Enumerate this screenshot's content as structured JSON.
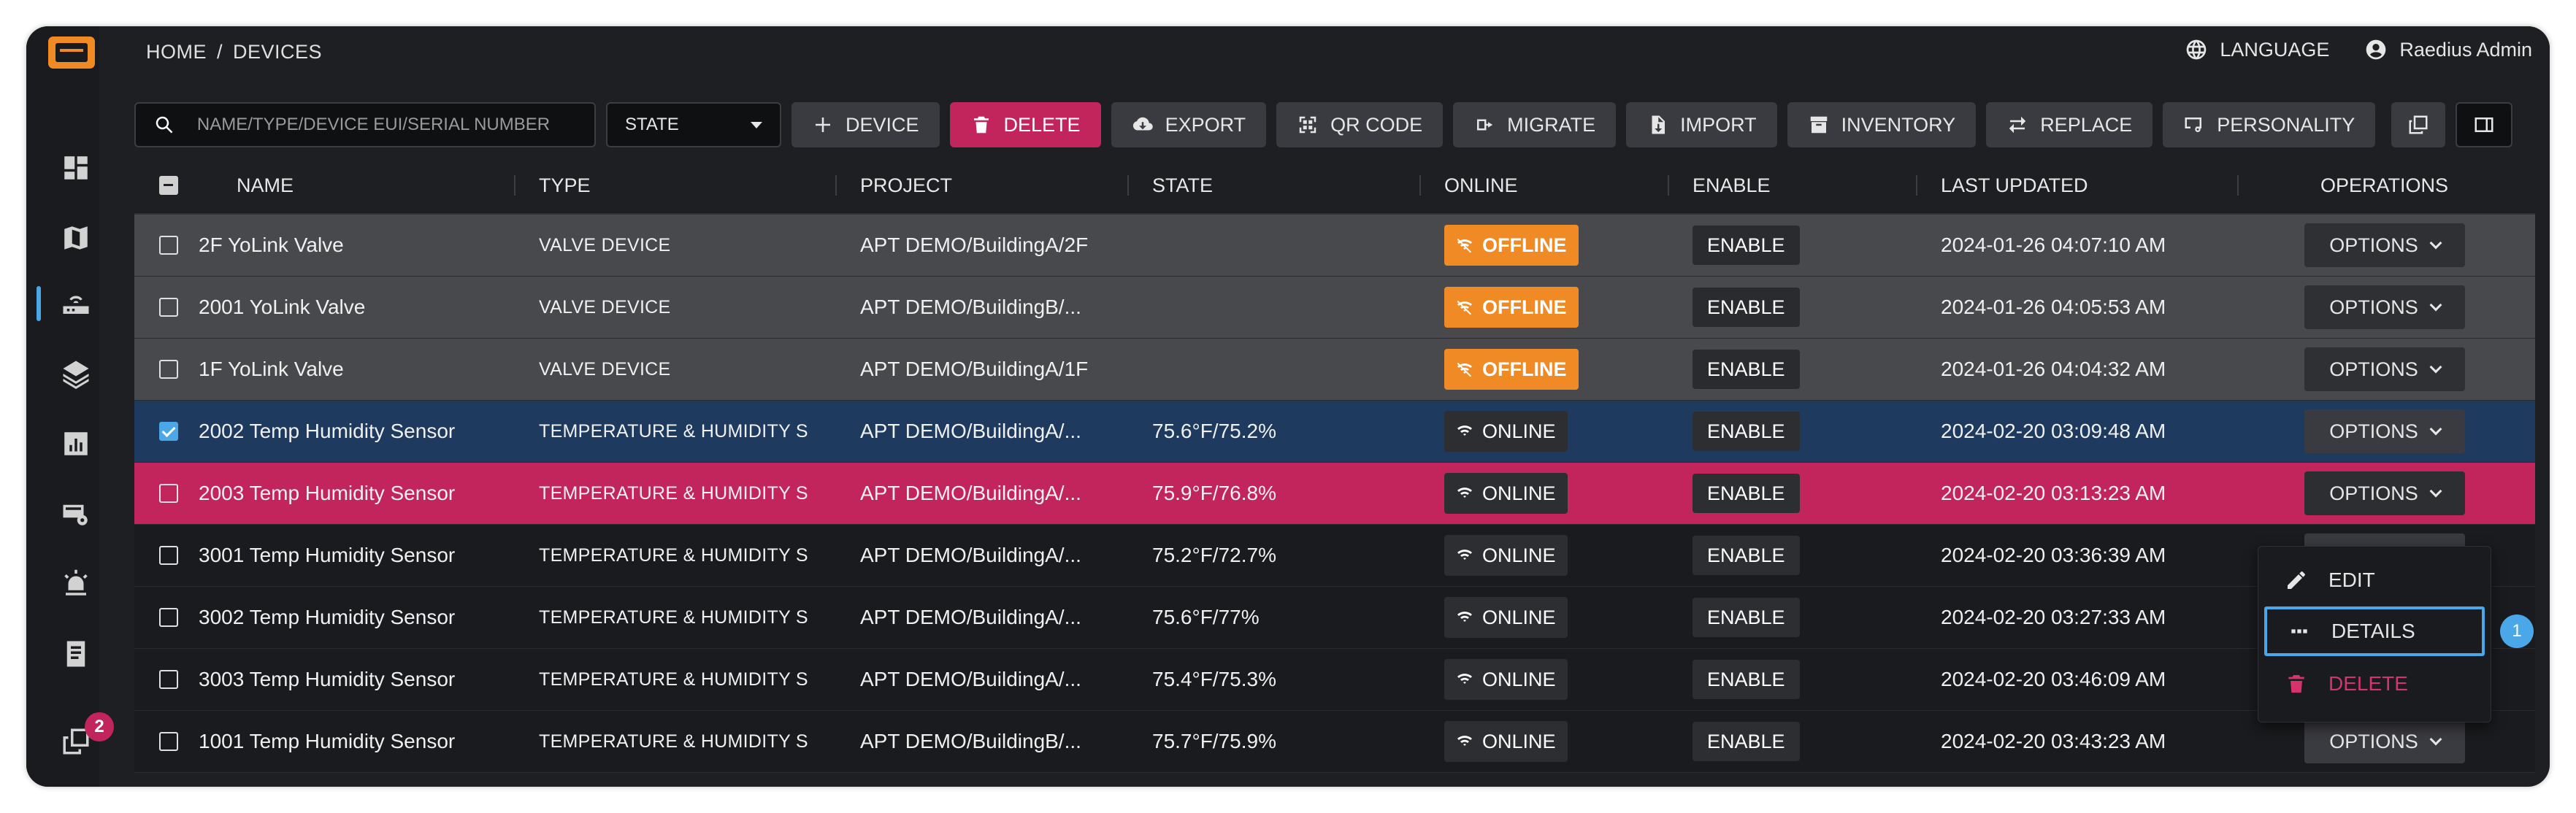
{
  "header": {
    "breadcrumb": [
      "HOME",
      "/",
      "DEVICES"
    ],
    "language_label": "LANGUAGE",
    "user_name": "Raedius Admin"
  },
  "sidebar": {
    "badge_count": "2",
    "active_item": "devices",
    "items": [
      "dashboard",
      "map",
      "devices",
      "layers",
      "analytics",
      "settings-devices",
      "alarms",
      "reports",
      "copies"
    ]
  },
  "toolbar": {
    "search_placeholder": "NAME/TYPE/DEVICE EUI/SERIAL NUMBER",
    "state_select": "STATE",
    "buttons": {
      "device": "DEVICE",
      "delete": "DELETE",
      "export": "EXPORT",
      "qr_code": "QR CODE",
      "migrate": "MIGRATE",
      "import": "IMPORT",
      "inventory": "INVENTORY",
      "replace": "REPLACE",
      "personality": "PERSONALITY"
    }
  },
  "table": {
    "headers": {
      "name": "NAME",
      "type": "TYPE",
      "project": "PROJECT",
      "state": "STATE",
      "online": "ONLINE",
      "enable": "ENABLE",
      "last_updated": "LAST UPDATED",
      "operations": "OPERATIONS"
    },
    "rows": [
      {
        "name": "2F YoLink Valve",
        "type": "VALVE DEVICE",
        "project": "APT DEMO/BuildingA/2F",
        "state": "",
        "online": "OFFLINE",
        "enable": "ENABLE",
        "last_updated": "2024-01-26 04:07:10 AM",
        "options": "OPTIONS"
      },
      {
        "name": "2001 YoLink Valve",
        "type": "VALVE DEVICE",
        "project": "APT DEMO/BuildingB/...",
        "state": "",
        "online": "OFFLINE",
        "enable": "ENABLE",
        "last_updated": "2024-01-26 04:05:53 AM",
        "options": "OPTIONS"
      },
      {
        "name": "1F YoLink Valve",
        "type": "VALVE DEVICE",
        "project": "APT DEMO/BuildingA/1F",
        "state": "",
        "online": "OFFLINE",
        "enable": "ENABLE",
        "last_updated": "2024-01-26 04:04:32 AM",
        "options": "OPTIONS"
      },
      {
        "name": "2002 Temp Humidity Sensor",
        "type": "TEMPERATURE & HUMIDITY S",
        "project": "APT DEMO/BuildingA/...",
        "state": "75.6°F/75.2%",
        "online": "ONLINE",
        "enable": "ENABLE",
        "last_updated": "2024-02-20 03:09:48 AM",
        "options": "OPTIONS"
      },
      {
        "name": "2003 Temp Humidity Sensor",
        "type": "TEMPERATURE & HUMIDITY S",
        "project": "APT DEMO/BuildingA/...",
        "state": "75.9°F/76.8%",
        "online": "ONLINE",
        "enable": "ENABLE",
        "last_updated": "2024-02-20 03:13:23 AM",
        "options": "OPTIONS"
      },
      {
        "name": "3001 Temp Humidity Sensor",
        "type": "TEMPERATURE & HUMIDITY S",
        "project": "APT DEMO/BuildingA/...",
        "state": "75.2°F/72.7%",
        "online": "ONLINE",
        "enable": "ENABLE",
        "last_updated": "2024-02-20 03:36:39 AM",
        "options": "OPTIONS"
      },
      {
        "name": "3002 Temp Humidity Sensor",
        "type": "TEMPERATURE & HUMIDITY S",
        "project": "APT DEMO/BuildingA/...",
        "state": "75.6°F/77%",
        "online": "ONLINE",
        "enable": "ENABLE",
        "last_updated": "2024-02-20 03:27:33 AM",
        "options": "OPTIONS"
      },
      {
        "name": "3003 Temp Humidity Sensor",
        "type": "TEMPERATURE & HUMIDITY S",
        "project": "APT DEMO/BuildingA/...",
        "state": "75.4°F/75.3%",
        "online": "ONLINE",
        "enable": "ENABLE",
        "last_updated": "2024-02-20 03:46:09 AM",
        "options": "OPTIONS"
      },
      {
        "name": "1001 Temp Humidity Sensor",
        "type": "TEMPERATURE & HUMIDITY S",
        "project": "APT DEMO/BuildingB/...",
        "state": "75.7°F/75.9%",
        "online": "ONLINE",
        "enable": "ENABLE",
        "last_updated": "2024-02-20 03:43:23 AM",
        "options": "OPTIONS"
      }
    ]
  },
  "options_menu": {
    "edit": "EDIT",
    "details": "DETAILS",
    "delete": "DELETE",
    "step_number": "1"
  },
  "colors": {
    "accent": "#4aa8e8",
    "danger": "#c2255c",
    "offline": "#f08a24",
    "brand": "#f08a24"
  }
}
